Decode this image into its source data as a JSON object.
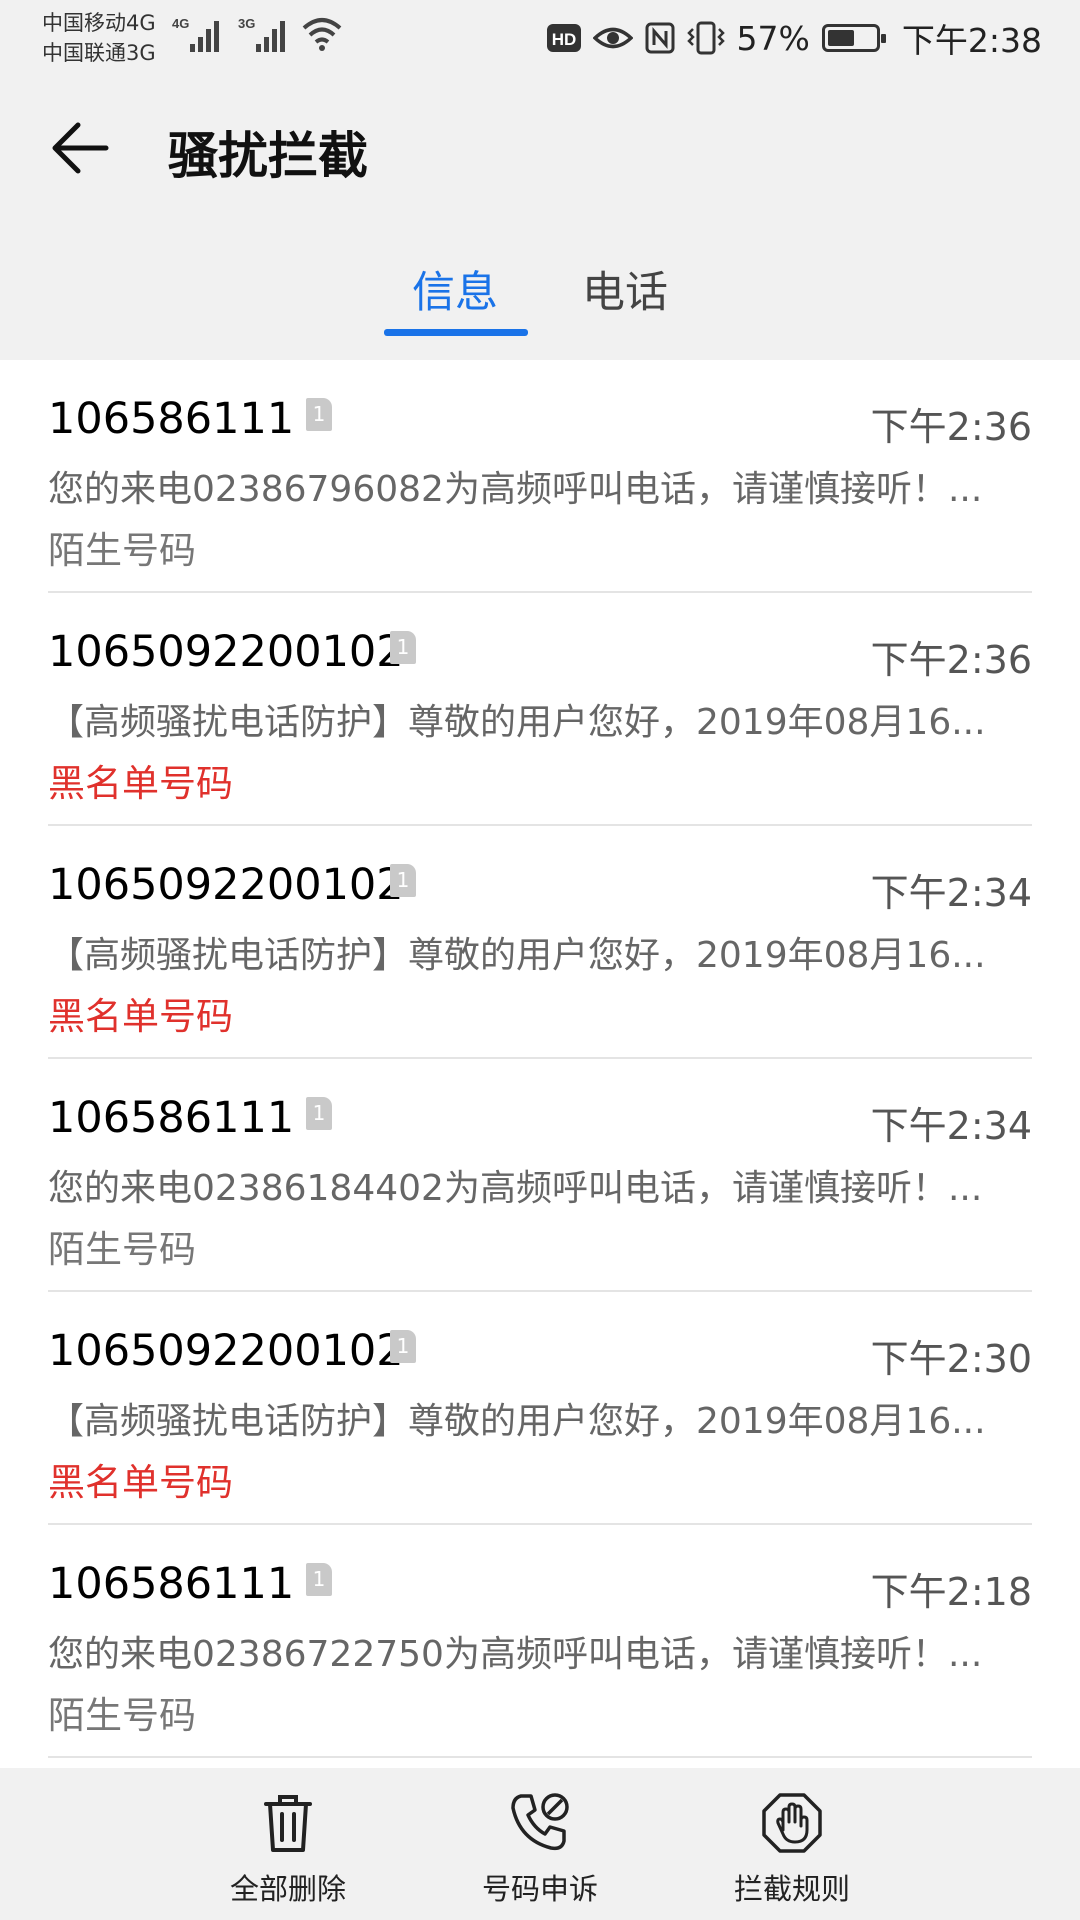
{
  "status_bar": {
    "carrier1": "中国移动4G",
    "carrier2": "中国联通3G",
    "sig1_tag": "4G",
    "sig2_tag": "3G",
    "hd": "HD",
    "battery_pct": "57%",
    "battery_level": 0.57,
    "time": "下午2:38"
  },
  "header": {
    "title": "骚扰拦截"
  },
  "tabs": [
    {
      "label": "信息",
      "selected": true
    },
    {
      "label": "电话",
      "selected": false
    }
  ],
  "messages": [
    {
      "sender": "106586111",
      "sim": "1",
      "time": "下午2:36",
      "preview": "您的来电02386796082为高频呼叫电话，请谨慎接听！...",
      "tag": "陌生号码",
      "tag_color": "#777777"
    },
    {
      "sender": "1065092200102",
      "sim": "1",
      "time": "下午2:36",
      "preview": "【高频骚扰电话防护】尊敬的用户您好，2019年08月16...",
      "tag": "黑名单号码",
      "tag_color": "#e0312c"
    },
    {
      "sender": "1065092200102",
      "sim": "1",
      "time": "下午2:34",
      "preview": "【高频骚扰电话防护】尊敬的用户您好，2019年08月16...",
      "tag": "黑名单号码",
      "tag_color": "#e0312c"
    },
    {
      "sender": "106586111",
      "sim": "1",
      "time": "下午2:34",
      "preview": "您的来电02386184402为高频呼叫电话，请谨慎接听！...",
      "tag": "陌生号码",
      "tag_color": "#777777"
    },
    {
      "sender": "1065092200102",
      "sim": "1",
      "time": "下午2:30",
      "preview": "【高频骚扰电话防护】尊敬的用户您好，2019年08月16...",
      "tag": "黑名单号码",
      "tag_color": "#e0312c"
    },
    {
      "sender": "106586111",
      "sim": "1",
      "time": "下午2:18",
      "preview": "您的来电02386722750为高频呼叫电话，请谨慎接听！...",
      "tag": "陌生号码",
      "tag_color": "#777777"
    }
  ],
  "bottom_bar": {
    "delete_all": "全部删除",
    "number_appeal": "号码申诉",
    "block_rules": "拦截规则"
  },
  "colors": {
    "accent": "#1a73e8",
    "blacklist": "#e0312c"
  }
}
